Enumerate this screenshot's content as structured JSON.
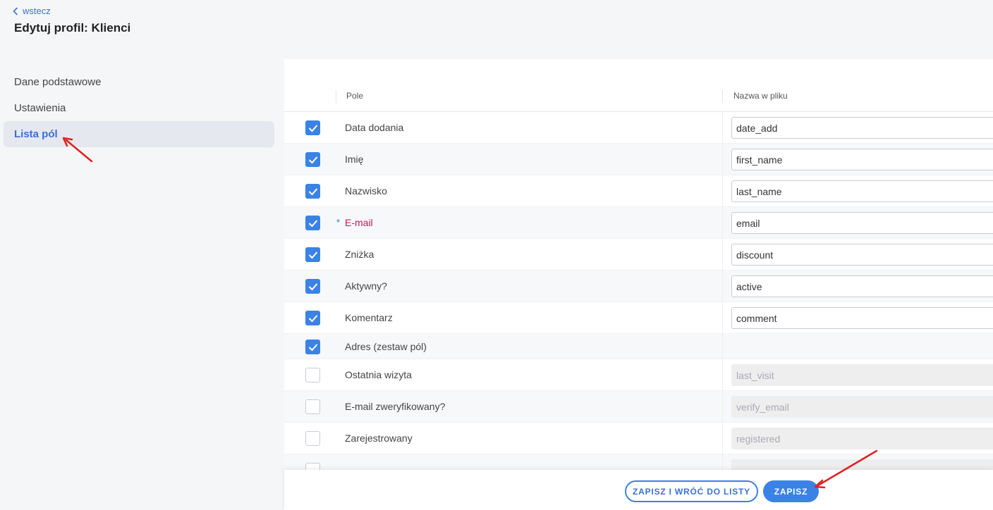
{
  "header": {
    "back_label": "wstecz",
    "title": "Edytuj profil: Klienci"
  },
  "sidebar": {
    "items": [
      {
        "label": "Dane podstawowe",
        "active": false
      },
      {
        "label": "Ustawienia",
        "active": false
      },
      {
        "label": "Lista pól",
        "active": true
      }
    ]
  },
  "table": {
    "columns": {
      "field": "Pole",
      "file_name": "Nazwa w pliku"
    },
    "rows": [
      {
        "checked": true,
        "label": "Data dodania",
        "value": "date_add"
      },
      {
        "checked": true,
        "label": "Imię",
        "value": "first_name"
      },
      {
        "checked": true,
        "label": "Nazwisko",
        "value": "last_name"
      },
      {
        "checked": true,
        "label": "E-mail",
        "value": "email",
        "required_marker": "*"
      },
      {
        "checked": true,
        "label": "Zniżka",
        "value": "discount"
      },
      {
        "checked": true,
        "label": "Aktywny?",
        "value": "active"
      },
      {
        "checked": true,
        "label": "Komentarz",
        "value": "comment"
      },
      {
        "checked": true,
        "label": "Adres (zestaw pól)"
      },
      {
        "checked": false,
        "label": "Ostatnia wizyta",
        "value": "last_visit"
      },
      {
        "checked": false,
        "label": "E-mail zweryfikowany?",
        "value": "verify_email"
      },
      {
        "checked": false,
        "label": "Zarejestrowany",
        "value": "registered"
      }
    ]
  },
  "footer": {
    "save_and_return_label": "ZAPISZ I WRÓĆ DO LISTY",
    "save_label": "ZAPISZ"
  },
  "colors": {
    "accent": "#3b82e6",
    "link": "#3a6fd8",
    "required": "#c2185b",
    "annotation_arrow": "#e02020"
  }
}
